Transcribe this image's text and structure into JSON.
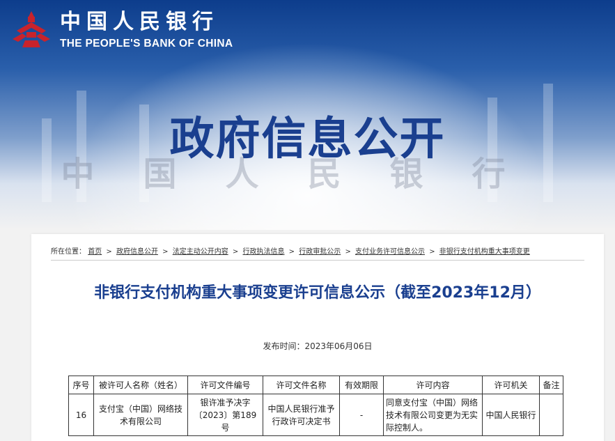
{
  "header": {
    "logo_cn": "中国人民银行",
    "logo_en": "THE PEOPLE'S BANK OF CHINA",
    "watermark": "中国人民银行",
    "section_title": "政府信息公开"
  },
  "breadcrumb": {
    "prefix": "所在位置：",
    "items": [
      "首页",
      "政府信息公开",
      "法定主动公开内容",
      "行政执法信息",
      "行政审批公示",
      "支付业务许可信息公示",
      "非银行支付机构重大事项变更"
    ],
    "separator": ">"
  },
  "article": {
    "title": "非银行支付机构重大事项变更许可信息公示（截至2023年12月）",
    "publish_time": "发布时间：2023年06月06日"
  },
  "table": {
    "headers": [
      "序号",
      "被许可人名称（姓名）",
      "许可文件编号",
      "许可文件名称",
      "有效期限",
      "许可内容",
      "许可机关",
      "备注"
    ],
    "rows": [
      [
        "16",
        "支付宝（中国）网络技术有限公司",
        "银许准予决字〔2023〕第189号",
        "中国人民银行准予行政许可决定书",
        "-",
        "同意支付宝（中国）网络技术有限公司变更为无实际控制人。",
        "中国人民银行",
        ""
      ]
    ]
  },
  "colors": {
    "brand_blue": "#1a3f8f",
    "banner_top": "#0d3d8c"
  }
}
